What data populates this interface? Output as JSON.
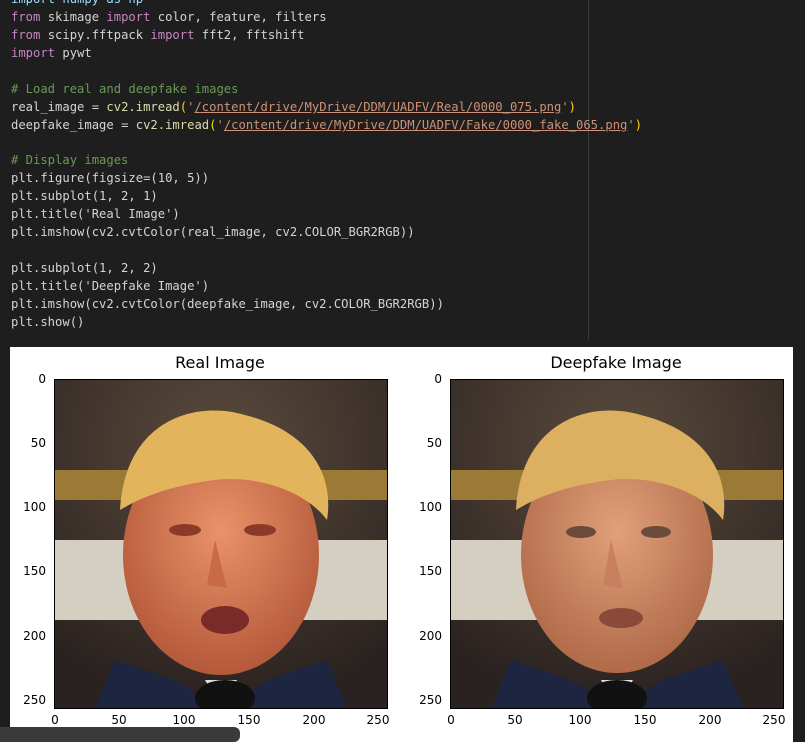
{
  "code": {
    "partial_top_line": "import numpy as np",
    "line1": [
      "from",
      " skimage ",
      "import",
      " color, feature, filters"
    ],
    "line2": [
      "from",
      " scipy.fftpack ",
      "import",
      " fft2, fftshift"
    ],
    "line3": [
      "import",
      " pywt"
    ],
    "comment1": "# Load real and deepfake images",
    "real_var": "real_image",
    "real_call": "cv2.imread",
    "real_path": "/content/drive/MyDrive/DDM/UADFV/Real/0000_075.png",
    "fake_var": "deepfake_image",
    "fake_call": "cv2.imread",
    "fake_path": "/content/drive/MyDrive/DDM/UADFV/Fake/0000_fake_065.png",
    "comment2": "# Display images",
    "figure_line": "plt.figure(figsize=(10, 5))",
    "subplot1": "plt.subplot(1, 2, 1)",
    "title1": "plt.title('Real Image')",
    "imshow1": "plt.imshow(cv2.cvtColor(real_image, cv2.COLOR_BGR2RGB))",
    "subplot2": "plt.subplot(1, 2, 2)",
    "title2": "plt.title('Deepfake Image')",
    "imshow2": "plt.imshow(cv2.cvtColor(deepfake_image, cv2.COLOR_BGR2RGB))",
    "show": "plt.show()"
  },
  "output": {
    "left_title": "Real Image",
    "right_title": "Deepfake Image",
    "y_ticks": [
      "0",
      "50",
      "100",
      "150",
      "200",
      "250"
    ],
    "x_ticks": [
      "0",
      "50",
      "100",
      "150",
      "200",
      "250"
    ]
  },
  "colors": {
    "editor_bg": "#1e1e1e",
    "keyword": "#c586c0",
    "comment": "#6a9955",
    "string": "#ce9178",
    "number": "#b5cea8",
    "function": "#dcdcaa"
  }
}
